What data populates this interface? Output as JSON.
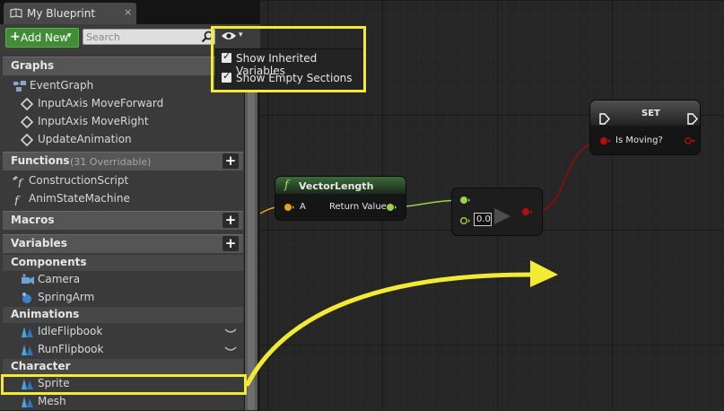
{
  "tab": {
    "title": "My Blueprint",
    "close": "×"
  },
  "toolbar": {
    "add_new_label": "Add New",
    "add_plus": "+",
    "caret": "▾",
    "search_placeholder": "Search"
  },
  "view_options": {
    "options": [
      {
        "label": "Show Inherited Variables",
        "checked": true,
        "mark": "✓"
      },
      {
        "label": "Show Empty Sections",
        "checked": true,
        "mark": "✓"
      }
    ]
  },
  "sections": {
    "graphs": {
      "title": "Graphs",
      "items": [
        "EventGraph",
        "InputAxis MoveForward",
        "InputAxis MoveRight",
        "UpdateAnimation"
      ]
    },
    "functions": {
      "title": "Functions",
      "subtitle": "(31 Overridable)",
      "plus": "+",
      "items": [
        "ConstructionScript",
        "AnimStateMachine"
      ]
    },
    "macros": {
      "title": "Macros",
      "plus": "+"
    },
    "variables": {
      "title": "Variables",
      "plus": "+",
      "categories": [
        {
          "title": "Components",
          "items": [
            "Camera",
            "SpringArm"
          ]
        },
        {
          "title": "Animations",
          "items": [
            "IdleFlipbook",
            "RunFlipbook"
          ]
        },
        {
          "title": "Character",
          "items": [
            "Sprite",
            "Mesh"
          ]
        }
      ]
    }
  },
  "graph": {
    "vector_length": {
      "title": "VectorLength",
      "pin_in": "A",
      "pin_out": "Return Value",
      "func_glyph": "f"
    },
    "compare": {
      "value": "0.0"
    },
    "set_node": {
      "title": "SET",
      "pin": "Is Moving?"
    }
  },
  "colors": {
    "highlight": "#f3eb33",
    "add_new": "#3f8e36",
    "exec_wire": "#8b0e0e",
    "float_wire": "#9bd14a",
    "vector_pin": "#e0a61f"
  }
}
